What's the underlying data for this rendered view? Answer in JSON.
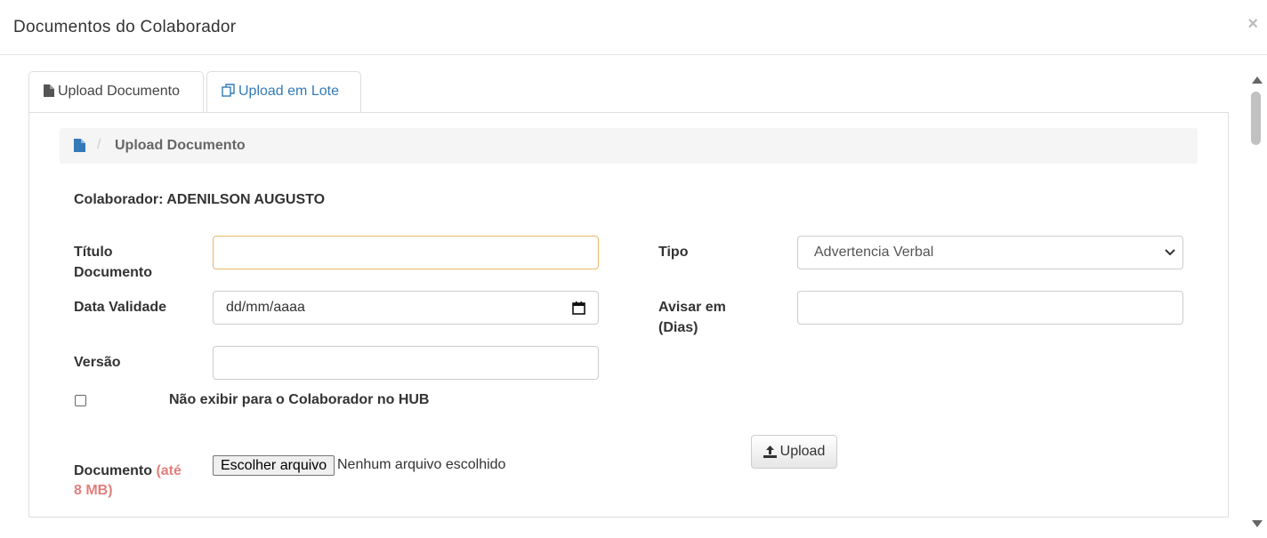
{
  "modal": {
    "title": "Documentos do Colaborador",
    "close": "×"
  },
  "tabs": [
    {
      "label": "Upload Documento",
      "icon": "file-icon",
      "active": true
    },
    {
      "label": "Upload em Lote",
      "icon": "copy-icon",
      "active": false
    }
  ],
  "breadcrumb": {
    "icon": "file-icon",
    "separator": "/",
    "label": "Upload Documento"
  },
  "form": {
    "colaborador": "Colaborador: ADENILSON AUGUSTO",
    "titulo_label_1": "Título",
    "titulo_label_2": "Documento",
    "titulo_value": "",
    "tipo_label": "Tipo",
    "tipo_value": "Advertencia Verbal",
    "data_label": "Data Validade",
    "data_placeholder": "dd/mm/aaaa",
    "avisar_label_1": "Avisar em",
    "avisar_label_2": "(Dias)",
    "avisar_value": "",
    "versao_label": "Versão",
    "versao_value": "",
    "hub_label": "Não exibir para o Colaborador no HUB",
    "hub_checked": false,
    "upload_button": "Upload",
    "documento_label": "Documento",
    "documento_limit_1": "(até",
    "documento_limit_2": "8 MB)",
    "file_button": "Escolher arquivo",
    "file_status": "Nenhum arquivo escolhido"
  },
  "colors": {
    "accent": "#337ab7",
    "focus_border": "#e6b86a",
    "limit_text": "#d9534f"
  }
}
